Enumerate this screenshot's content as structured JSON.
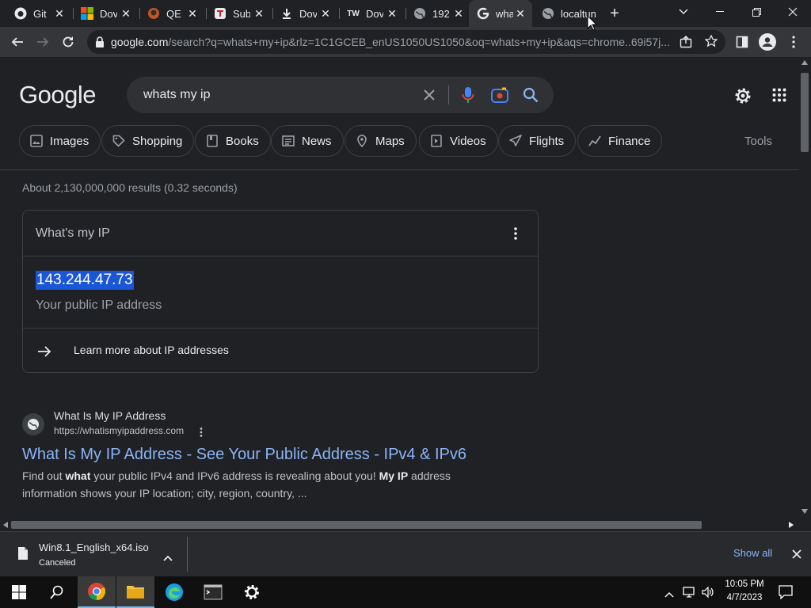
{
  "browser": {
    "tabs": [
      {
        "title": "Git",
        "icon": "github-icon"
      },
      {
        "title": "Dov",
        "icon": "microsoft-icon"
      },
      {
        "title": "QE",
        "icon": "qemu-icon"
      },
      {
        "title": "Sub",
        "icon": "subtitle-icon"
      },
      {
        "title": "Dov",
        "icon": "download-icon"
      },
      {
        "title": "Dov",
        "icon": "tw-icon"
      },
      {
        "title": "192",
        "icon": "globe-icon"
      },
      {
        "title": "wha",
        "icon": "google-icon"
      },
      {
        "title": "localtun",
        "icon": "globe-icon"
      }
    ],
    "active_tab_index": 7,
    "url_host": "google.com",
    "url_rest": "/search?q=whats+my+ip&rlz=1C1GCEB_enUS1050US1050&oq=whats+my+ip&aqs=chrome..69i57j..."
  },
  "search": {
    "logo": "Google",
    "query": "whats my ip",
    "chips": [
      "Images",
      "Shopping",
      "Books",
      "News",
      "Maps",
      "Videos",
      "Flights",
      "Finance"
    ],
    "tools_label": "Tools",
    "stats": "About 2,130,000,000 results (0.32 seconds)"
  },
  "ip_card": {
    "heading": "What's my IP",
    "ip": "143.244.47.73",
    "subtitle": "Your public IP address",
    "learn_more": "Learn more about IP addresses"
  },
  "result": {
    "site_name": "What Is My IP Address",
    "site_url": "https://whatismyipaddress.com",
    "title": "What Is My IP Address - See Your Public Address - IPv4 & IPv6",
    "snippet_parts": [
      "Find out ",
      "what",
      " your public IPv4 and IPv6 address is revealing about you! ",
      "My IP",
      " address information shows your IP location; city, region, country, ..."
    ]
  },
  "download": {
    "filename": "Win8.1_English_x64.iso",
    "status": "Canceled",
    "show_all": "Show all"
  },
  "taskbar": {
    "time": "10:05 PM",
    "date": "4/7/2023"
  },
  "colors": {
    "bg": "#202124",
    "link": "#8ab4f8",
    "selection": "#1a56d6"
  }
}
